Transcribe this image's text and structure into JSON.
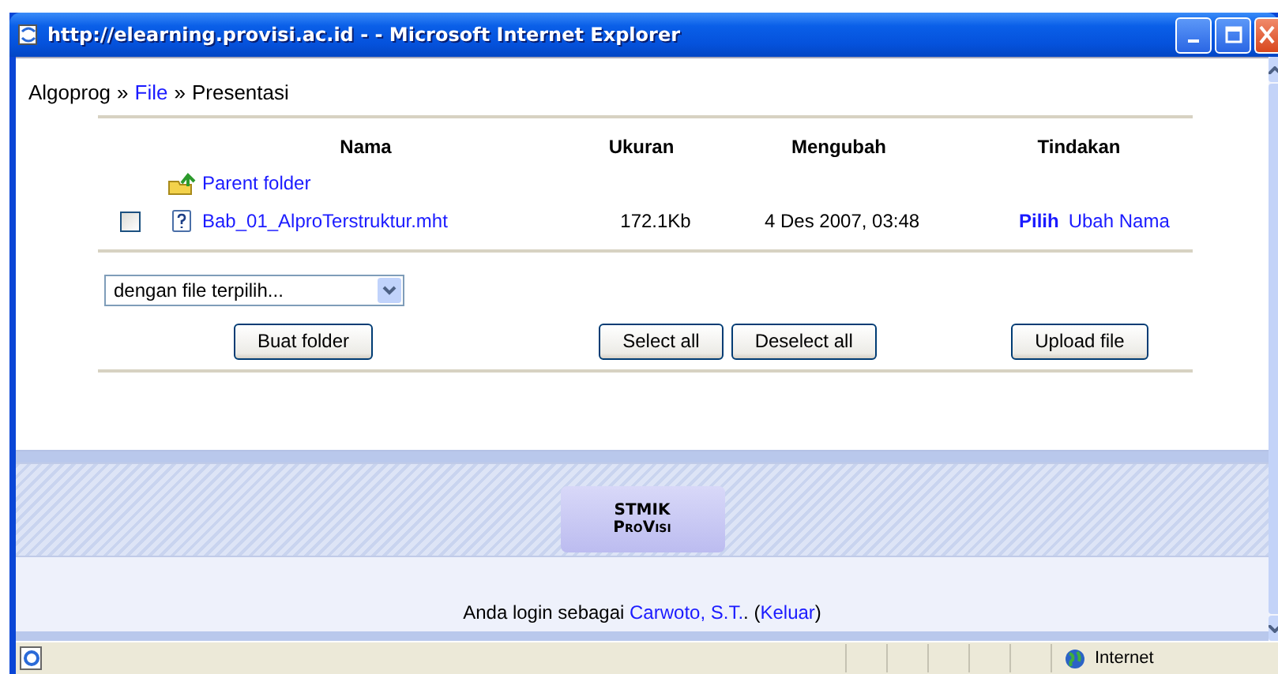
{
  "window": {
    "title": "http://elearning.provisi.ac.id - - Microsoft Internet Explorer"
  },
  "breadcrumb": {
    "items": [
      {
        "text": "Algoprog",
        "link": false
      },
      {
        "text": "File",
        "link": true
      },
      {
        "text": "Presentasi",
        "link": false
      }
    ],
    "separators": [
      "»",
      "»"
    ]
  },
  "table": {
    "columns": [
      "Nama",
      "Ukuran",
      "Mengubah",
      "Tindakan"
    ],
    "parent_folder": {
      "label": "Parent folder"
    },
    "rows": [
      {
        "checked": false,
        "name": "Bab_01_AlproTerstruktur.mht",
        "size": "172.1Kb",
        "modified": "4 Des 2007, 03:48",
        "actions": [
          {
            "label": "Pilih",
            "bold": true
          },
          {
            "label": "Ubah Nama",
            "bold": false
          }
        ]
      }
    ]
  },
  "action_select": {
    "value": "dengan file terpilih..."
  },
  "buttons": {
    "left": [
      "Buat folder"
    ],
    "center": [
      "Select all",
      "Deselect all"
    ],
    "right": [
      "Upload file"
    ]
  },
  "footer": {
    "logo": {
      "line1": "STMIK",
      "line2": "ProVisi"
    },
    "login": {
      "before": "Anda login sebagai",
      "user": "Carwoto, S.T.",
      "between": ". (",
      "logout": "Keluar",
      "after": ")"
    }
  },
  "status_bar": {
    "zone": "Internet"
  }
}
